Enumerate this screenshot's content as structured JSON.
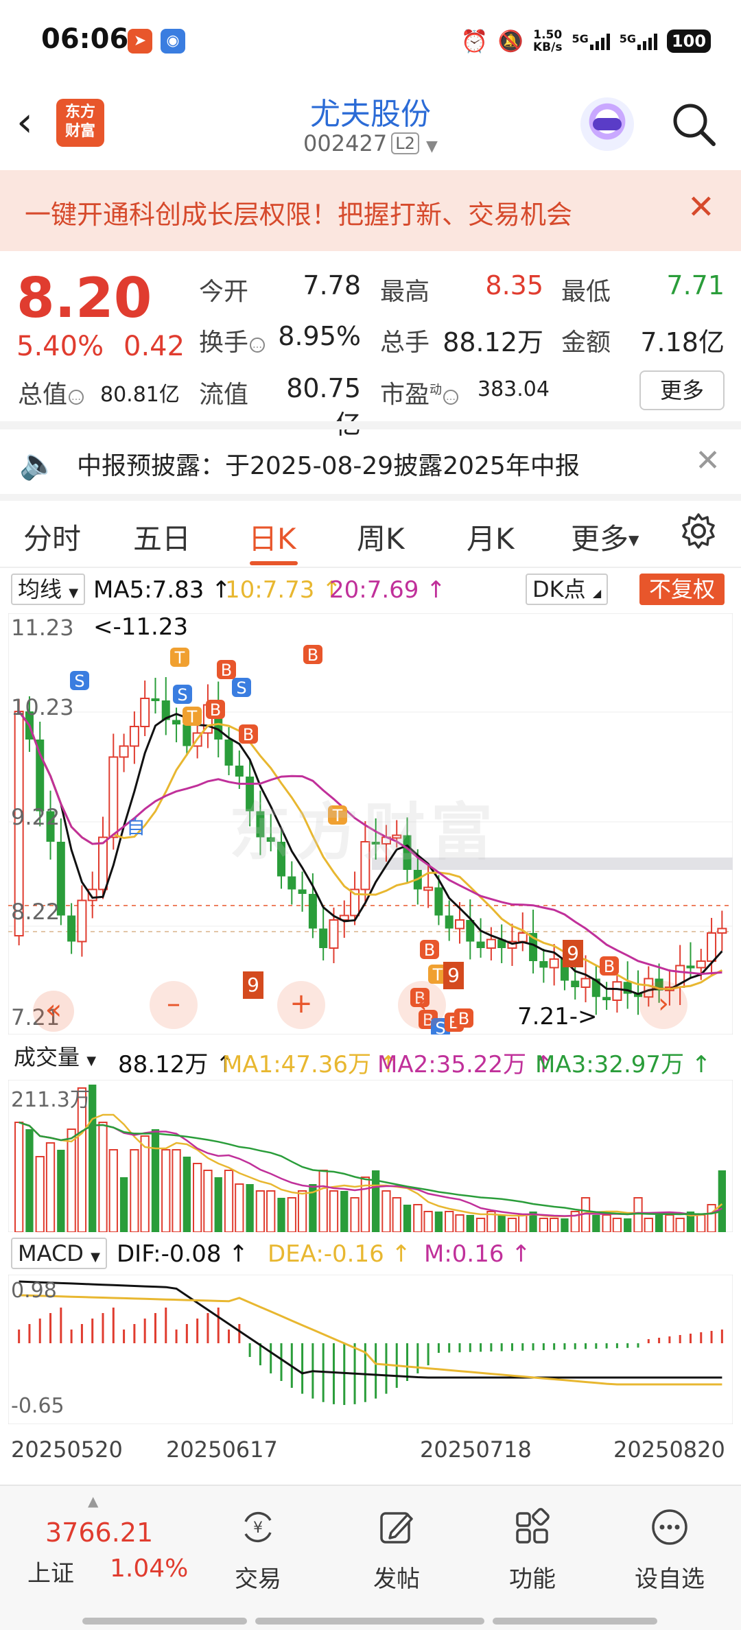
{
  "status_bar": {
    "time": "06:06",
    "net_speed": "1.50",
    "net_unit": "KB/s",
    "net1": "5G",
    "net2": "5G",
    "battery": "100"
  },
  "header": {
    "title": "尤夫股份",
    "code": "002427",
    "level_badge": "L2",
    "logo_text_line1": "东方",
    "logo_text_line2": "财富"
  },
  "banner": {
    "text": "一键开通科创成长层权限！把握打新、交易机会",
    "close": "✕"
  },
  "quote": {
    "price": "8.20",
    "change_pct": "5.40%",
    "change": "0.42",
    "open_label": "今开",
    "open": "7.78",
    "high_label": "最高",
    "high": "8.35",
    "low_label": "最低",
    "low": "7.71",
    "turnover_label": "换手",
    "turnover": "8.95%",
    "volume_label": "总手",
    "volume": "88.12万",
    "amount_label": "金额",
    "amount": "7.18亿",
    "mktcap_label": "总值",
    "mktcap": "80.81亿",
    "float_label": "流值",
    "float_cap": "80.75亿",
    "pe_label": "市盈",
    "pe_sup": "动",
    "pe": "383.04",
    "more": "更多"
  },
  "notice": {
    "text": "中报预披露：于2025-08-29披露2025年中报",
    "close": "✕"
  },
  "tabs": [
    "分时",
    "五日",
    "日K",
    "周K",
    "月K",
    "更多"
  ],
  "active_tab": "日K",
  "indicators": {
    "ma_selector": "均线",
    "ma5": "MA5:7.83 ↑",
    "ma10": "10:7.73 ↑",
    "ma20": "20:7.69 ↑",
    "dk": "DK点",
    "adjust": "不复权"
  },
  "kline": {
    "axis": [
      "11.23",
      "10.23",
      "9.22",
      "8.22",
      "7.21"
    ],
    "max_label": "<-11.23",
    "min_label": "7.21->",
    "watermark": "东方财富",
    "self_label": "自",
    "marker_9a": "9",
    "marker_9b": "9",
    "marker_9c": "9"
  },
  "volume": {
    "selector": "成交量",
    "value": "88.12万 ↑",
    "ma1": "MA1:47.36万 ↑",
    "ma2": "MA2:35.22万 ↑",
    "ma3": "MA3:32.97万 ↑",
    "axis_max": "211.3万"
  },
  "macd": {
    "selector": "MACD",
    "dif": "DIF:-0.08 ↑",
    "dea": "DEA:-0.16 ↑",
    "m": "M:0.16 ↑",
    "axis_top": "0.98",
    "axis_bottom": "-0.65"
  },
  "dates": [
    "20250520",
    "20250617",
    "20250718",
    "20250820"
  ],
  "bottom_bar": {
    "index_value": "3766.21",
    "index_name": "上证",
    "index_pct": "1.04%",
    "nav": [
      "交易",
      "发帖",
      "功能",
      "设自选"
    ]
  },
  "colors": {
    "up": "#e03c2f",
    "down": "#2a9d3a",
    "accent": "#e8562b",
    "ma5": "#111111",
    "ma10": "#e8b730",
    "ma20": "#c0309a"
  }
}
